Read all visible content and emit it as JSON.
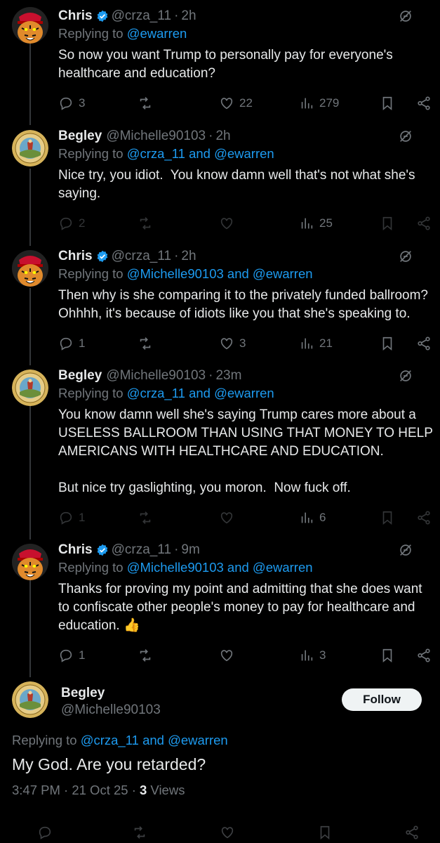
{
  "tweets": [
    {
      "name": "Chris",
      "verified": true,
      "handle": "@crza_11",
      "time": "2h",
      "replying_prefix": "Replying to ",
      "replying_to": "@ewarren",
      "text": "So now you want Trump to personally pay for everyone's\nhealthcare and education?",
      "replies": "3",
      "retweets": "",
      "likes": "22",
      "views": "279"
    },
    {
      "name": "Begley",
      "verified": false,
      "handle": "@Michelle90103",
      "time": "2h",
      "replying_prefix": "Replying to ",
      "replying_to": "@crza_11 and @ewarren",
      "text": "Nice try, you idiot.  You know damn well that's not what she's\nsaying.",
      "replies": "2",
      "retweets": "",
      "likes": "",
      "views": "25"
    },
    {
      "name": "Chris",
      "verified": true,
      "handle": "@crza_11",
      "time": "2h",
      "replying_prefix": "Replying to ",
      "replying_to": "@Michelle90103 and @ewarren",
      "text": "Then why is she comparing it to the privately funded ballroom?\nOhhhh, it's because of idiots like you that she's speaking to.",
      "replies": "1",
      "retweets": "",
      "likes": "3",
      "views": "21"
    },
    {
      "name": "Begley",
      "verified": false,
      "handle": "@Michelle90103",
      "time": "23m",
      "replying_prefix": "Replying to ",
      "replying_to": "@crza_11 and @ewarren",
      "text": "You know damn well she's saying Trump cares more about a\nUSELESS BALLROOM THAN USING THAT MONEY TO HELP\nAMERICANS WITH HEALTHCARE AND EDUCATION.\n\nBut nice try gaslighting, you moron.  Now fuck off.",
      "replies": "1",
      "retweets": "",
      "likes": "",
      "views": "6"
    },
    {
      "name": "Chris",
      "verified": true,
      "handle": "@crza_11",
      "time": "9m",
      "replying_prefix": "Replying to ",
      "replying_to": "@Michelle90103 and @ewarren",
      "text": "Thanks for proving my point and admitting that she does want\nto confiscate other people's money to pay for healthcare and\neducation. 👍",
      "replies": "1",
      "retweets": "",
      "likes": "",
      "views": "3"
    }
  ],
  "main": {
    "name": "Begley",
    "handle": "@Michelle90103",
    "follow_label": "Follow",
    "replying_prefix": "Replying to ",
    "replying_to": "@crza_11 and @ewarren",
    "text": "My God.  Are you retarded?",
    "timestamp": "3:47 PM · 21 Oct 25 · ",
    "views_count": "3",
    "views_label": " Views"
  },
  "separator": "·",
  "colors": {
    "background": "#000000",
    "text": "#e7e9ea",
    "muted": "#71767b",
    "link": "#1d9bf0",
    "verified": "#1d9bf0",
    "follow_bg": "#eff3f4"
  },
  "icons": [
    "reply-icon",
    "retweet-icon",
    "like-icon",
    "views-icon",
    "bookmark-icon",
    "share-icon",
    "hidden-reply-icon",
    "verified-badge-icon",
    "tiger-avatar",
    "seal-avatar"
  ]
}
